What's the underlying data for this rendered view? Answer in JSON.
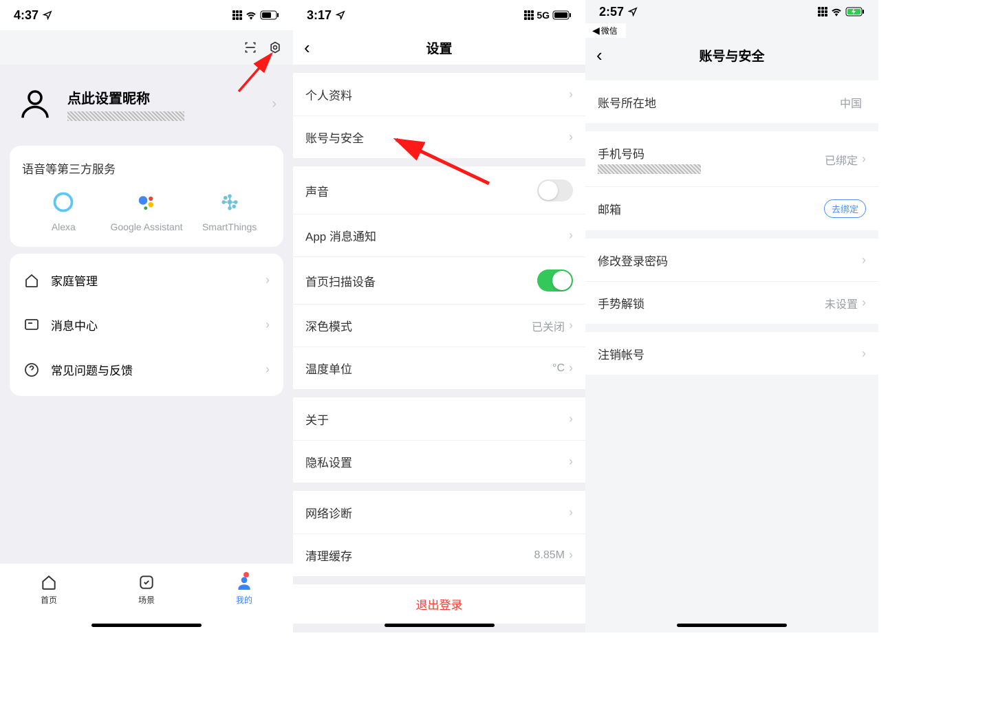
{
  "screen1": {
    "status": {
      "time": "4:37"
    },
    "nickname": "点此设置昵称",
    "services": {
      "title": "语音等第三方服务",
      "items": [
        {
          "label": "Alexa"
        },
        {
          "label": "Google Assistant"
        },
        {
          "label": "SmartThings"
        }
      ]
    },
    "menu": [
      {
        "label": "家庭管理"
      },
      {
        "label": "消息中心"
      },
      {
        "label": "常见问题与反馈"
      }
    ],
    "tabs": [
      {
        "label": "首页"
      },
      {
        "label": "场景"
      },
      {
        "label": "我的"
      }
    ]
  },
  "screen2": {
    "status": {
      "time": "3:17",
      "network": "5G"
    },
    "title": "设置",
    "group1": [
      {
        "label": "个人资料"
      },
      {
        "label": "账号与安全"
      }
    ],
    "group2": {
      "sound": "声音",
      "app_notify": "App 消息通知",
      "home_scan": "首页扫描设备",
      "dark_mode": {
        "label": "深色模式",
        "value": "已关闭"
      },
      "temp_unit": {
        "label": "温度单位",
        "value": "°C"
      }
    },
    "group3": [
      {
        "label": "关于"
      },
      {
        "label": "隐私设置"
      }
    ],
    "group4": {
      "net_diag": "网络诊断",
      "clear_cache": {
        "label": "清理缓存",
        "value": "8.85M"
      }
    },
    "logout": "退出登录"
  },
  "screen3": {
    "status": {
      "time": "2:57"
    },
    "back_app": "微信",
    "title": "账号与安全",
    "region": {
      "label": "账号所在地",
      "value": "中国"
    },
    "phone": {
      "label": "手机号码",
      "value": "已绑定"
    },
    "email": {
      "label": "邮箱",
      "button": "去绑定"
    },
    "pwd": "修改登录密码",
    "gesture": {
      "label": "手势解锁",
      "value": "未设置"
    },
    "delete": "注销帐号"
  }
}
